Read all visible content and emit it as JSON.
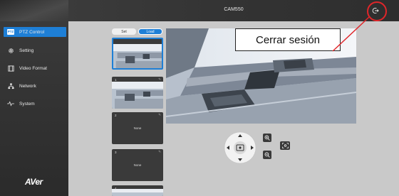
{
  "app": {
    "title": "CAM550",
    "logo": "AVer"
  },
  "sidebar": {
    "items": [
      {
        "label": "PTZ Control",
        "icon": "ptz-icon",
        "badge": "PTZ",
        "active": true
      },
      {
        "label": "Setting",
        "icon": "gear-icon",
        "active": false
      },
      {
        "label": "Video Format",
        "icon": "film-icon",
        "active": false
      },
      {
        "label": "Network",
        "icon": "network-icon",
        "active": false
      },
      {
        "label": "System",
        "icon": "pulse-icon",
        "active": false
      }
    ]
  },
  "presets": {
    "set_label": "Set",
    "load_label": "Load",
    "items": [
      {
        "number": "",
        "label": "",
        "has_image": true,
        "selected": true
      },
      {
        "number": "1",
        "label": "",
        "has_image": true,
        "selected": false
      },
      {
        "number": "2",
        "label": "None",
        "has_image": false,
        "selected": false
      },
      {
        "number": "3",
        "label": "None",
        "has_image": false,
        "selected": false
      },
      {
        "number": "4",
        "label": "",
        "has_image": true,
        "selected": false
      }
    ]
  },
  "annotation": {
    "callout_text": "Cerrar sesión",
    "color": "#e0262a"
  },
  "colors": {
    "accent": "#1e7fd6",
    "sidebar_bg": "#333333",
    "content_bg": "#c9c9c9"
  },
  "icons": {
    "logout": "logout-icon",
    "zoom_in": "zoom-in-icon",
    "zoom_out": "zoom-out-icon",
    "focus": "focus-icon"
  }
}
